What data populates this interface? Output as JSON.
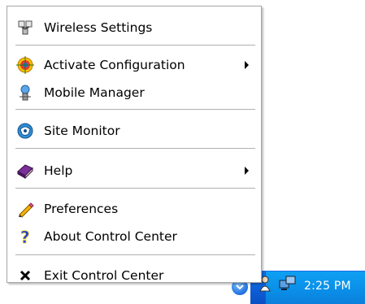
{
  "menu": {
    "items": [
      {
        "label": "Wireless Settings",
        "icon": "wireless-settings-icon",
        "submenu": false
      },
      {
        "label": "Activate Configuration",
        "icon": "target-icon",
        "submenu": true
      },
      {
        "label": "Mobile Manager",
        "icon": "mobile-manager-icon",
        "submenu": false
      },
      {
        "label": "Site Monitor",
        "icon": "site-monitor-icon",
        "submenu": false
      },
      {
        "label": "Help",
        "icon": "help-book-icon",
        "submenu": true
      },
      {
        "label": "Preferences",
        "icon": "pencil-icon",
        "submenu": false
      },
      {
        "label": "About Control Center",
        "icon": "question-mark-icon",
        "submenu": false
      },
      {
        "label": "Exit Control Center",
        "icon": "close-x-icon",
        "submenu": false
      }
    ]
  },
  "taskbar": {
    "clock": "2:25 PM",
    "colors": {
      "taskbar": "#0d5fd8",
      "tray": "#0a8ee8"
    }
  }
}
